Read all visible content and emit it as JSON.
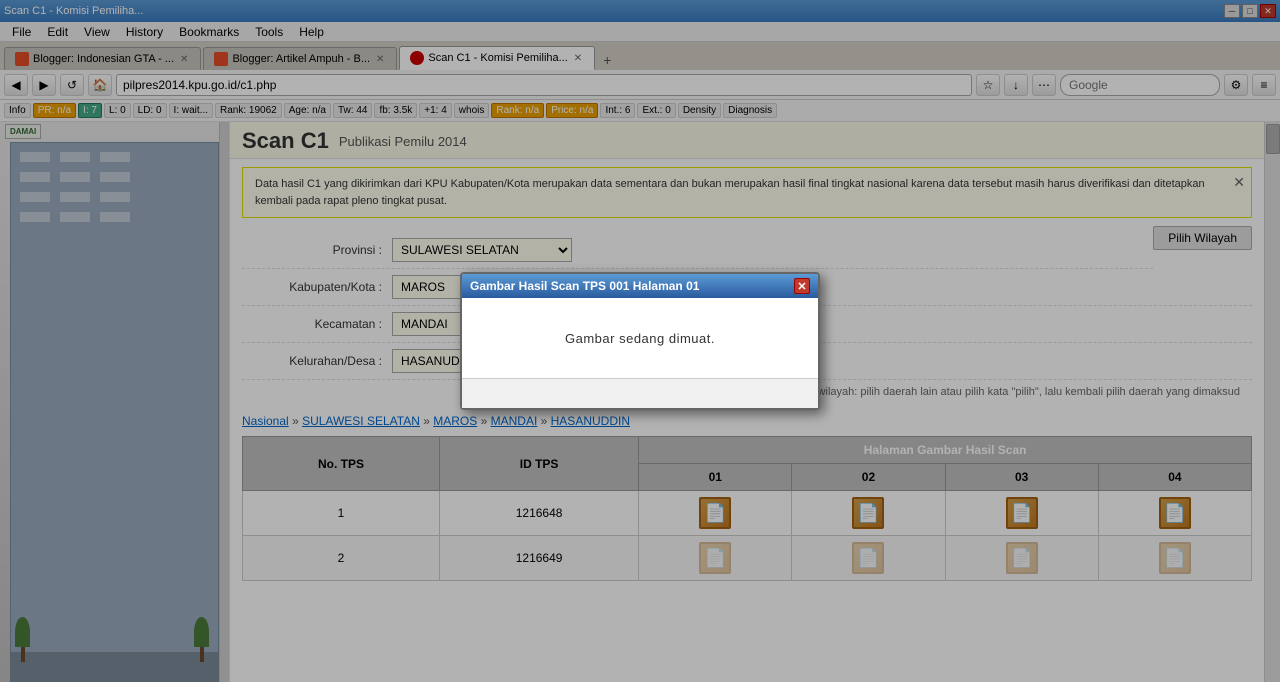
{
  "browser": {
    "title": "Scan C1 - Komisi Pemiliha...",
    "tabs": [
      {
        "id": "tab1",
        "label": "Blogger: Indonesian GTA - ...",
        "favicon_color": "#e44d26",
        "active": false
      },
      {
        "id": "tab2",
        "label": "Blogger: Artikel Ampuh - B...",
        "favicon_color": "#e44d26",
        "active": false
      },
      {
        "id": "tab3",
        "label": "Scan C1 - Komisi Pemiliha...",
        "favicon_color": "#cc0000",
        "active": true
      }
    ],
    "address": "pilpres2014.kpu.go.id/c1.php",
    "search_placeholder": "Google",
    "menu_items": [
      "File",
      "Edit",
      "View",
      "History",
      "Bookmarks",
      "Tools",
      "Help"
    ],
    "title_bar_controls": [
      "-",
      "□",
      "✕"
    ]
  },
  "toolbar": {
    "items": [
      {
        "label": "Info",
        "type": "normal"
      },
      {
        "label": "PR: n/a",
        "type": "orange"
      },
      {
        "label": "I: 7",
        "type": "green"
      },
      {
        "label": "L: 0",
        "type": "normal"
      },
      {
        "label": "LD: 0",
        "type": "normal"
      },
      {
        "label": "I: wait...",
        "type": "normal"
      },
      {
        "label": "Rank: 19062",
        "type": "normal"
      },
      {
        "label": "Age: n/a",
        "type": "normal"
      },
      {
        "label": "Tw: 44",
        "type": "normal"
      },
      {
        "label": "fb: 3.5k",
        "type": "normal"
      },
      {
        "label": "+1: 4",
        "type": "normal"
      },
      {
        "label": "whois",
        "type": "normal"
      },
      {
        "label": "Rank: n/a",
        "type": "orange"
      },
      {
        "label": "Price: n/a",
        "type": "orange"
      },
      {
        "label": "Int.: 6",
        "type": "normal"
      },
      {
        "label": "Ext.: 0",
        "type": "normal"
      },
      {
        "label": "Density",
        "type": "normal"
      },
      {
        "label": "Diagnosis",
        "type": "normal"
      }
    ]
  },
  "page": {
    "main_title": "Scan C1",
    "sub_title": "Publikasi Pemilu 2014",
    "notice_text": "Data hasil C1 yang dikirimkan dari KPU Kabupaten/Kota merupakan data sementara dan bukan merupakan hasil final tingkat nasional karena data tersebut masih harus diverifikasi dan ditetapkan kembali pada rapat pleno tingkat pusat.",
    "pilih_btn": "Pilih Wilayah",
    "form": {
      "fields": [
        {
          "label": "Provinsi :",
          "value": "SULAWESI SELATAN",
          "id": "provinsi"
        },
        {
          "label": "Kabupaten/Kota :",
          "value": "MAROS",
          "id": "kabupaten"
        },
        {
          "label": "Kecamatan :",
          "value": "MANDAI",
          "id": "kecamatan"
        },
        {
          "label": "Kelurahan/Desa :",
          "value": "HASANUDDIN",
          "id": "kelurahan"
        }
      ],
      "refresh_hint": "Cara me-refresh wilayah: pilih daerah lain atau pilih kata \"pilih\", lalu kembali pilih daerah yang dimaksud"
    },
    "breadcrumb": {
      "items": [
        "Nasional",
        "SULAWESI SELATAN",
        "MAROS",
        "MANDAI",
        "HASANUDDIN"
      ]
    },
    "table": {
      "col_headers": [
        "No. TPS",
        "ID TPS"
      ],
      "scan_header": "Halaman Gambar Hasil Scan",
      "scan_cols": [
        "01",
        "02",
        "03",
        "04"
      ],
      "rows": [
        {
          "no": "1",
          "id": "1216648",
          "scans": [
            true,
            true,
            true,
            true
          ]
        },
        {
          "no": "2",
          "id": "1216649",
          "scans": [
            true,
            true,
            true,
            true
          ]
        }
      ]
    }
  },
  "modal": {
    "title": "Gambar Hasil Scan TPS 001 Halaman 01",
    "body_text": "Gambar sedang dimuat.",
    "close_label": "✕"
  }
}
